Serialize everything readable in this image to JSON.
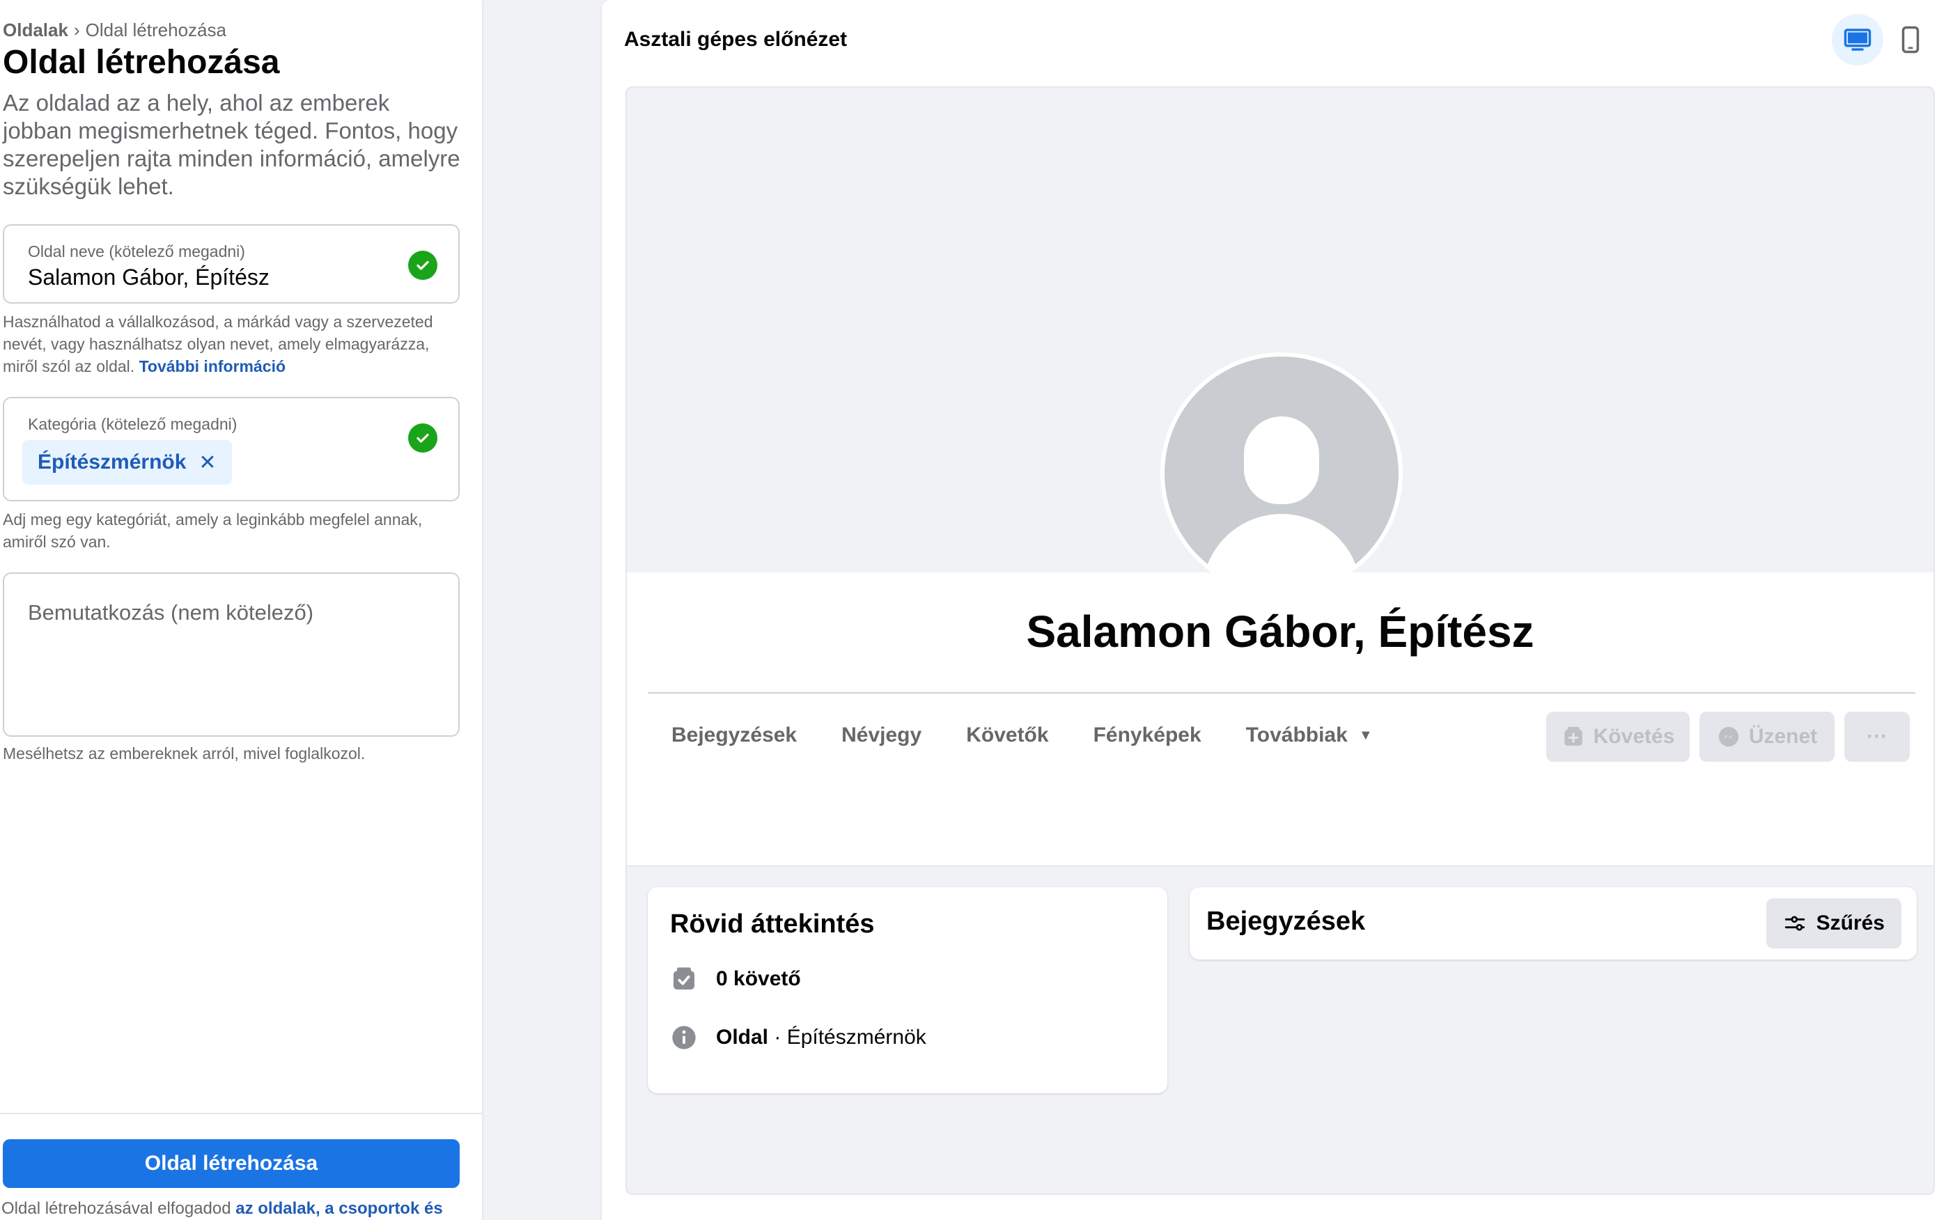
{
  "breadcrumb": {
    "parent": "Oldalak",
    "separator": "›",
    "current": "Oldal létrehozása"
  },
  "page_title": "Oldal létrehozása",
  "intro": "Az oldalad az a hely, ahol az emberek jobban megismerhetnek téged. Fontos, hogy szerepeljen rajta minden információ, amelyre szükségük lehet.",
  "form": {
    "name": {
      "label": "Oldal neve (kötelező megadni)",
      "value": "Salamon Gábor, Építész",
      "helper": "Használhatod a vállalkozásod, a márkád vagy a szervezeted nevét, vagy használhatsz olyan nevet, amely elmagyarázza, miről szól az oldal.",
      "helper_link": "További információ"
    },
    "category": {
      "label": "Kategória (kötelező megadni)",
      "chip": "Építészmérnök",
      "chip_remove": "✕",
      "helper": "Adj meg egy kategóriát, amely a leginkább megfelel annak, amiről szó van."
    },
    "bio": {
      "placeholder": "Bemutatkozás (nem kötelező)",
      "helper": "Mesélhetsz az embereknek arról, mivel foglalkozol."
    }
  },
  "create_button": "Oldal létrehozása",
  "terms": {
    "text": "Oldal létrehozásával elfogadod",
    "link": "az oldalak, a csoportok és"
  },
  "preview": {
    "title": "Asztali gépes előnézet",
    "device_icons": [
      "desktop-icon",
      "mobile-icon"
    ],
    "profile_name": "Salamon Gábor, Építész",
    "tabs": [
      "Bejegyzések",
      "Névjegy",
      "Követők",
      "Fényképek",
      "Továbbiak"
    ],
    "more_caret": "▼",
    "actions": {
      "follow": "Követés",
      "message": "Üzenet",
      "more": "···"
    },
    "intro_card": {
      "title": "Rövid áttekintés",
      "followers": "0 követő",
      "type_label": "Oldal",
      "type_sep": " · ",
      "type_value": "Építészmérnök"
    },
    "posts_card": {
      "title": "Bejegyzések",
      "filter": "Szűrés"
    }
  },
  "colors": {
    "accent": "#1b74e4",
    "link": "#1f5bb8",
    "success": "#1aa41a",
    "chip_bg": "#e7f3ff"
  }
}
